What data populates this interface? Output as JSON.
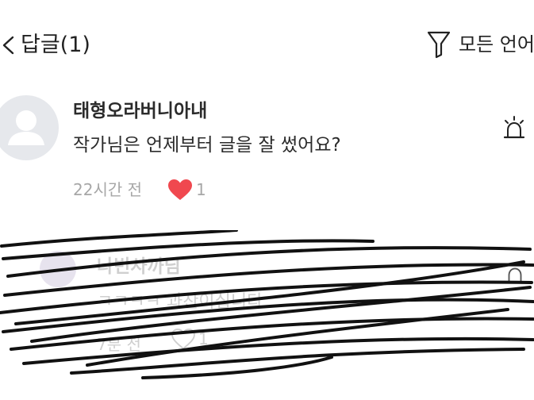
{
  "header": {
    "title": "답글(1)",
    "filter_label": "모든 언어"
  },
  "comments": [
    {
      "author": "태형오라버니아내",
      "body": "작가님은 언제부터 글을 잘 썼어요?",
      "time": "22시간 전",
      "likes": "1",
      "liked": true
    }
  ],
  "redacted_reply": {
    "author": "나빈사까님",
    "body": "ㅋㅋㅋㅋ 과찬이십니다",
    "time": "7분 전",
    "likes": "1"
  },
  "icons": {
    "back": "chevron-left-icon",
    "filter": "funnel-icon",
    "avatar": "default-avatar-icon",
    "report": "siren-icon",
    "like": "heart-icon"
  },
  "colors": {
    "like_heart": "#f0484f",
    "meta_text": "#a7a7a7",
    "avatar_bg": "#e6e8ec"
  }
}
